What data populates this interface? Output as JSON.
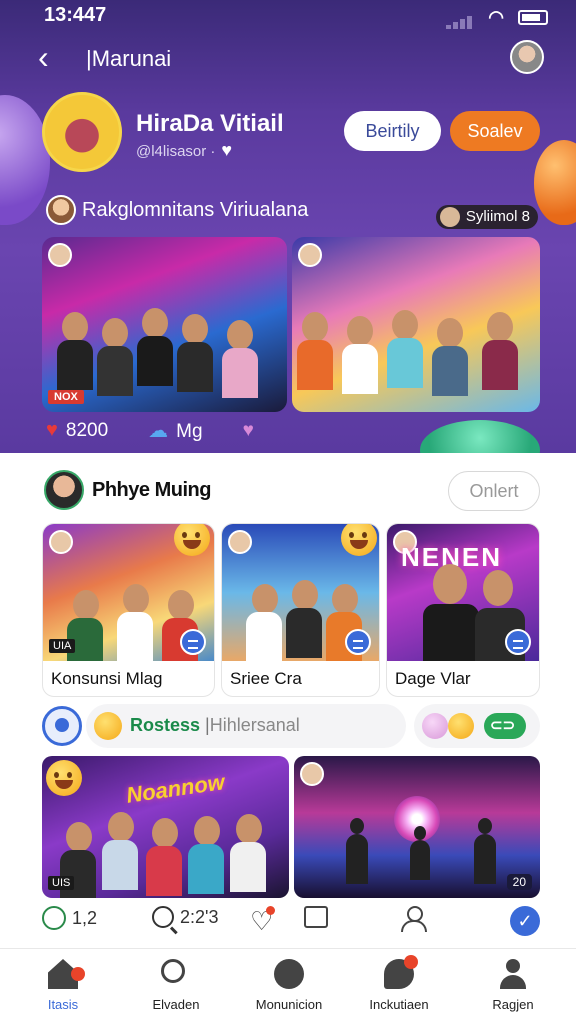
{
  "status": {
    "time": "13:447"
  },
  "nav": {
    "title": "|Marunai"
  },
  "profile": {
    "name": "HiraDa Vitiail",
    "handle": "@l4lisasor ·",
    "follow_label": "Beirtily",
    "action_label": "Soalev"
  },
  "community": {
    "name": "Rakglomnitans Viriualana",
    "tag": "Syliimol 8"
  },
  "post": {
    "badge": "NOX",
    "stats": [
      {
        "icon": "heart-icon",
        "value": "8200"
      },
      {
        "icon": "cloud-icon",
        "value": "Mg"
      }
    ]
  },
  "section2": {
    "name": "Phhye Muing",
    "online_label": "Onlert"
  },
  "cards": [
    {
      "label": "Konsunsi Mlag",
      "tag": "UIA"
    },
    {
      "label": "Sriee Cra"
    },
    {
      "label": "Dage Vlar",
      "neon": "NENEN"
    }
  ],
  "search": {
    "prefix": "Rostess",
    "separator": "|",
    "placeholder": "Hihlersanal"
  },
  "gallery": [
    {
      "title": "Noannow",
      "tag": "UIS"
    },
    {
      "badge": "20"
    }
  ],
  "actions": [
    {
      "icon": "comment-icon",
      "value": "1,2"
    },
    {
      "icon": "search-icon",
      "value": "2:2'3"
    }
  ],
  "bottom_nav": [
    {
      "label": "Itasis",
      "icon": "home-icon"
    },
    {
      "label": "Elvaden",
      "icon": "search-icon"
    },
    {
      "label": "Monunicion",
      "icon": "chart-icon"
    },
    {
      "label": "Inckutiaen",
      "icon": "chat-icon"
    },
    {
      "label": "Ragjen",
      "icon": "person-icon"
    }
  ]
}
